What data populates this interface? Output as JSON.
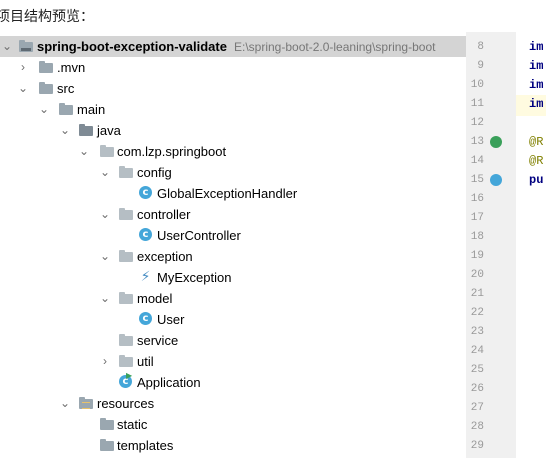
{
  "caption": "项目结构预览：",
  "project": {
    "name": "spring-boot-exception-validate",
    "path": "E:\\spring-boot-2.0-leaning\\spring-boot"
  },
  "tree": [
    {
      "label": "spring-boot-exception-validate",
      "icon": "project-folder-icon",
      "expanded": true,
      "depth": 0
    },
    {
      "label": ".mvn",
      "icon": "folder-icon",
      "expanded": false,
      "depth": 1
    },
    {
      "label": "src",
      "icon": "folder-icon",
      "expanded": true,
      "depth": 1
    },
    {
      "label": "main",
      "icon": "folder-icon",
      "expanded": true,
      "depth": 2
    },
    {
      "label": "java",
      "icon": "source-folder-icon",
      "expanded": true,
      "depth": 3
    },
    {
      "label": "com.lzp.springboot",
      "icon": "package-icon",
      "expanded": true,
      "depth": 4
    },
    {
      "label": "config",
      "icon": "package-icon",
      "expanded": true,
      "depth": 5
    },
    {
      "label": "GlobalExceptionHandler",
      "icon": "class-icon",
      "depth": 6
    },
    {
      "label": "controller",
      "icon": "package-icon",
      "expanded": true,
      "depth": 5
    },
    {
      "label": "UserController",
      "icon": "class-icon",
      "depth": 6
    },
    {
      "label": "exception",
      "icon": "package-icon",
      "expanded": true,
      "depth": 5
    },
    {
      "label": "MyException",
      "icon": "exception-class-icon",
      "depth": 6
    },
    {
      "label": "model",
      "icon": "package-icon",
      "expanded": true,
      "depth": 5
    },
    {
      "label": "User",
      "icon": "class-icon",
      "depth": 6
    },
    {
      "label": "service",
      "icon": "package-icon",
      "depth": 5
    },
    {
      "label": "util",
      "icon": "package-icon",
      "expanded": false,
      "depth": 5
    },
    {
      "label": "Application",
      "icon": "spring-boot-class-icon",
      "depth": 5
    },
    {
      "label": "resources",
      "icon": "resources-folder-icon",
      "expanded": true,
      "depth": 3
    },
    {
      "label": "static",
      "icon": "folder-icon",
      "depth": 4
    },
    {
      "label": "templates",
      "icon": "folder-icon",
      "depth": 4
    }
  ],
  "class_icon_letter": "c",
  "gutter": {
    "line_numbers": [
      "8",
      "9",
      "10",
      "11",
      "12",
      "13",
      "14",
      "15",
      "16",
      "17",
      "18",
      "19",
      "20",
      "21",
      "22",
      "23",
      "24",
      "25",
      "26",
      "27",
      "28",
      "29"
    ],
    "current_line": "11"
  },
  "code_fragments": [
    "im",
    "im",
    "im",
    "im",
    "@R",
    "@R",
    "pu"
  ],
  "colors": {
    "selected_row": "#d4d4d4",
    "class_icon": "#44a6d9",
    "keyword": "#000080",
    "annotation": "#808000",
    "gutter_bg": "#f0f0f0"
  }
}
